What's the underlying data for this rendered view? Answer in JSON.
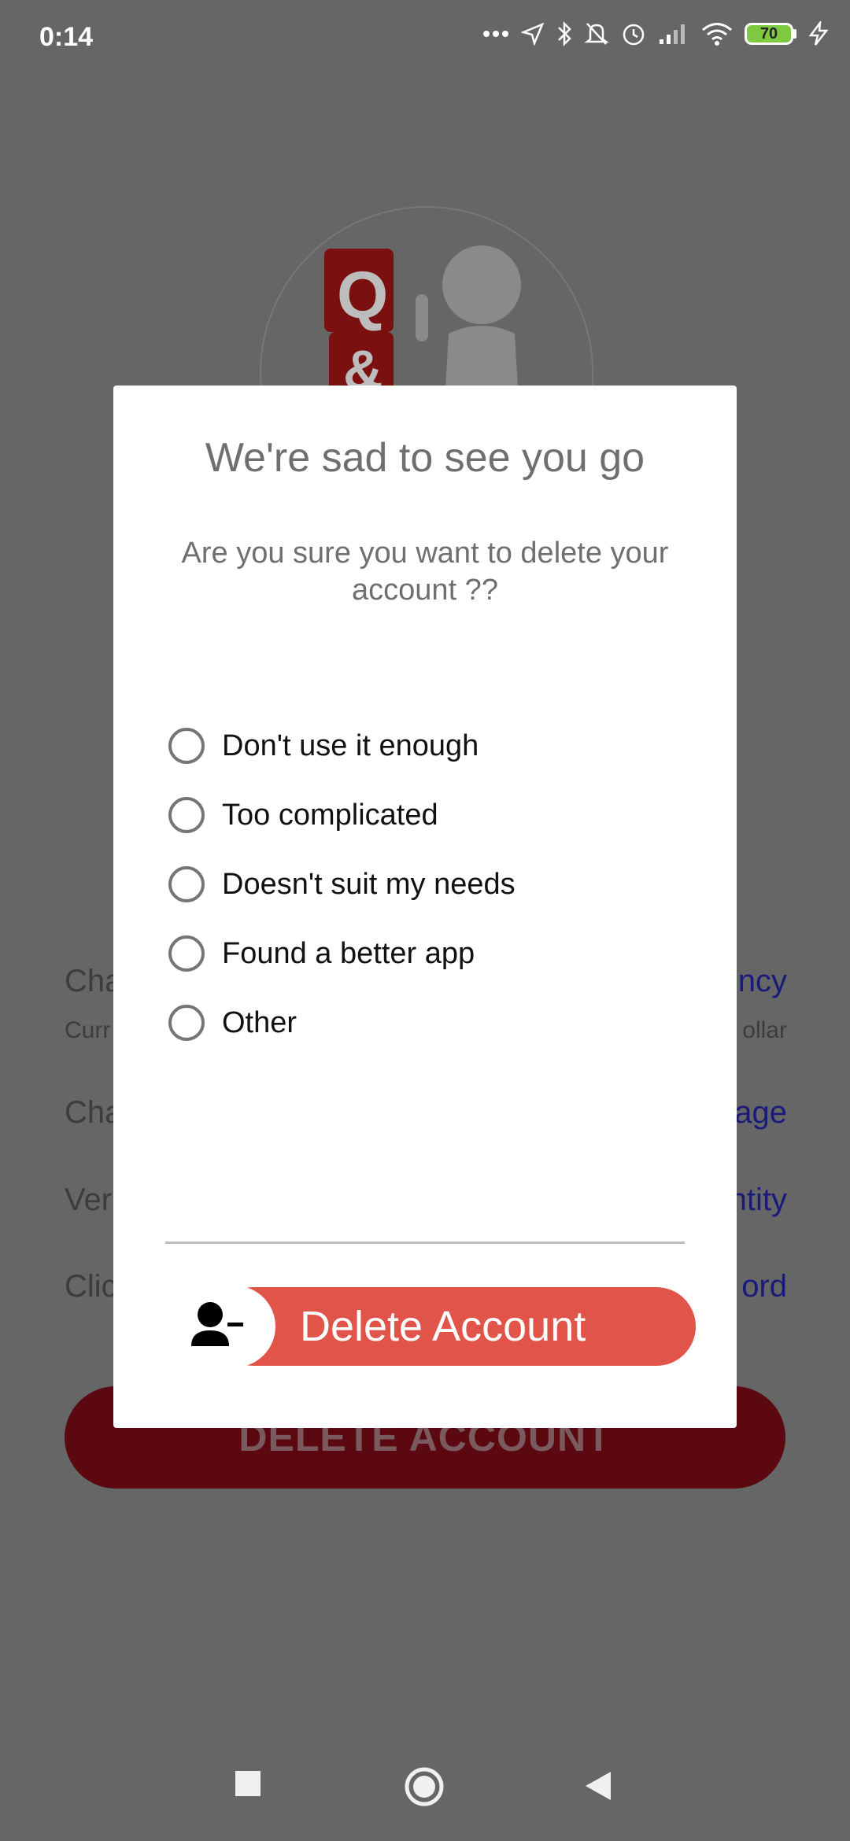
{
  "status_bar": {
    "time": "0:14",
    "battery": "70",
    "icons": [
      "dots-icon",
      "location-icon",
      "bluetooth-icon",
      "mute-icon",
      "alarm-icon",
      "signal-icon",
      "wifi-icon",
      "battery-icon",
      "charging-icon"
    ]
  },
  "background": {
    "rows": [
      {
        "left": "Cha",
        "right": "ncy"
      },
      {
        "left": "Cha",
        "right": "age"
      },
      {
        "left": "Ver",
        "right": "ntity"
      },
      {
        "left": "Clic",
        "right": "ord"
      }
    ],
    "sub_row": {
      "left": "Curr",
      "right": "ollar"
    },
    "delete_button": "DELETE ACCOUNT"
  },
  "dialog": {
    "title": "We're sad to see you go",
    "message": "Are you sure you want to delete your account ??",
    "options": [
      {
        "label": "Don't use it enough",
        "selected": false
      },
      {
        "label": "Too complicated",
        "selected": false
      },
      {
        "label": "Doesn't suit my needs",
        "selected": false
      },
      {
        "label": "Found a better app",
        "selected": false
      },
      {
        "label": "Other",
        "selected": false
      }
    ],
    "delete_button": "Delete Account"
  },
  "colors": {
    "scrim": "#666666",
    "accent_red": "#e0544a",
    "dark_red": "#5b0810",
    "link_blue": "#1a1a7a"
  }
}
